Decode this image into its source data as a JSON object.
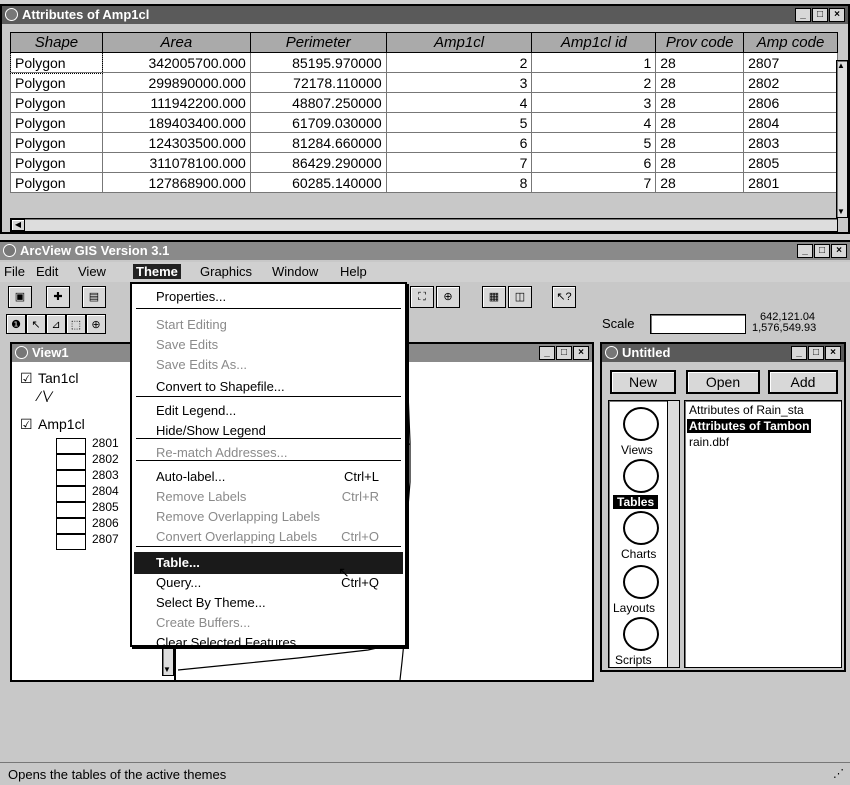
{
  "attr_window": {
    "title": "Attributes of Amp1cl",
    "columns": [
      "Shape",
      "Area",
      "Perimeter",
      "Amp1cl",
      "Amp1cl id",
      "Prov code",
      "Amp code"
    ],
    "rows": [
      [
        "Polygon",
        "342005700.000",
        "85195.970000",
        "2",
        "1",
        "28",
        "2807"
      ],
      [
        "Polygon",
        "299890000.000",
        "72178.110000",
        "3",
        "2",
        "28",
        "2802"
      ],
      [
        "Polygon",
        "111942200.000",
        "48807.250000",
        "4",
        "3",
        "28",
        "2806"
      ],
      [
        "Polygon",
        "189403400.000",
        "61709.030000",
        "5",
        "4",
        "28",
        "2804"
      ],
      [
        "Polygon",
        "124303500.000",
        "81284.660000",
        "6",
        "5",
        "28",
        "2803"
      ],
      [
        "Polygon",
        "311078100.000",
        "86429.290000",
        "7",
        "6",
        "28",
        "2805"
      ],
      [
        "Polygon",
        "127868900.000",
        "60285.140000",
        "8",
        "7",
        "28",
        "2801"
      ]
    ]
  },
  "app": {
    "title": "ArcView GIS Version 3.1",
    "menus": [
      "File",
      "Edit",
      "View",
      "Theme",
      "Graphics",
      "Window",
      "Help"
    ],
    "scale_label": "Scale",
    "coord_x": "642,121.04",
    "coord_y": "1,576,549.93",
    "status": "Opens the tables of the active themes"
  },
  "theme_menu": {
    "items": [
      {
        "label": "Properties...",
        "shortcut": "",
        "disabled": false
      },
      {
        "label": "Start Editing",
        "shortcut": "",
        "disabled": true
      },
      {
        "label": "Save Edits",
        "shortcut": "",
        "disabled": true
      },
      {
        "label": "Save Edits As...",
        "shortcut": "",
        "disabled": true
      },
      {
        "label": "Convert to Shapefile...",
        "shortcut": "",
        "disabled": false
      },
      {
        "label": "Edit Legend...",
        "shortcut": "",
        "disabled": false
      },
      {
        "label": "Hide/Show Legend",
        "shortcut": "",
        "disabled": false
      },
      {
        "label": "Re-match Addresses...",
        "shortcut": "",
        "disabled": true
      },
      {
        "label": "Auto-label...",
        "shortcut": "Ctrl+L",
        "disabled": false
      },
      {
        "label": "Remove Labels",
        "shortcut": "Ctrl+R",
        "disabled": true
      },
      {
        "label": "Remove Overlapping Labels",
        "shortcut": "",
        "disabled": true
      },
      {
        "label": "Convert Overlapping Labels",
        "shortcut": "Ctrl+O",
        "disabled": true
      },
      {
        "label": "Table...",
        "shortcut": "",
        "disabled": false
      },
      {
        "label": "Query...",
        "shortcut": "Ctrl+Q",
        "disabled": false
      },
      {
        "label": "Select By Theme...",
        "shortcut": "",
        "disabled": false
      },
      {
        "label": "Create Buffers...",
        "shortcut": "",
        "disabled": true
      },
      {
        "label": "Clear Selected Features",
        "shortcut": "",
        "disabled": false
      }
    ]
  },
  "view_window": {
    "title": "View1",
    "themes": [
      {
        "name": "Tan1cl",
        "checked": true
      },
      {
        "name": "Amp1cl",
        "checked": true
      }
    ],
    "legend": [
      "2801",
      "2802",
      "2803",
      "2804",
      "2805",
      "2806",
      "2807"
    ]
  },
  "project_window": {
    "title": "Untitled",
    "buttons": [
      "New",
      "Open",
      "Add"
    ],
    "doc_types": [
      "Views",
      "Tables",
      "Charts",
      "Layouts",
      "Scripts"
    ],
    "selected_type": "Tables",
    "items": [
      "Attributes of Rain_sta",
      "Attributes of Tambon",
      "rain.dbf"
    ],
    "selected_item": "Attributes of Tambon"
  }
}
